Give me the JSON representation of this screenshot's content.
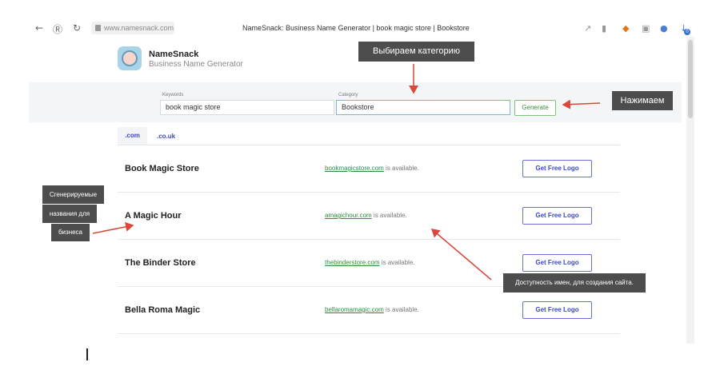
{
  "browser": {
    "url": "www.namesnack.com",
    "page_title": "NameSnack: Business Name Generator | book magic store | Bookstore",
    "extension_badge": "0"
  },
  "header": {
    "brand": "NameSnack",
    "subtitle": "Business Name Generator"
  },
  "search": {
    "keywords_label": "Keywords",
    "keywords_value": "book magic store",
    "category_label": "Category",
    "category_value": "Bookstore",
    "generate_label": "Generate"
  },
  "tabs": [
    {
      "label": ".com",
      "active": true
    },
    {
      "label": ".co.uk",
      "active": false
    }
  ],
  "results": [
    {
      "name": "Book Magic Store",
      "domain": "bookmagicstore.com",
      "status": " is available.",
      "button": "Get Free Logo"
    },
    {
      "name": "A Magic Hour",
      "domain": "amagichour.com",
      "status": " is available.",
      "button": "Get Free Logo"
    },
    {
      "name": "The Binder Store",
      "domain": "thebinderstore.com",
      "status": " is available.",
      "button": "Get Free Logo"
    },
    {
      "name": "Bella Roma Magic",
      "domain": "bellaromamagic.com",
      "status": " is available.",
      "button": "Get Free Logo"
    }
  ],
  "annotations": {
    "choose_category": "Выбираем категорию",
    "press": "Нажимаем",
    "generated_line1": "Сгенерируемые",
    "generated_line2": "названия для",
    "generated_line3": "бизнеса",
    "availability": "Доступность имен, для создания сайта."
  },
  "colors": {
    "annotation_bg": "#4d4d4d",
    "arrow": "#d9483b",
    "link_green": "#2e8b3a",
    "accent_blue": "#3a48c8"
  }
}
